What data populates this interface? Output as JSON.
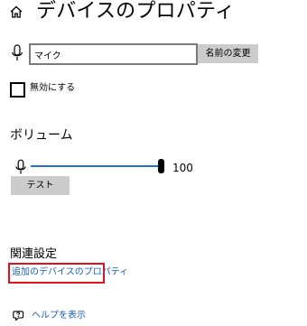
{
  "header": {
    "title": "デバイスのプロパティ",
    "home_icon": "home-icon"
  },
  "device_name": {
    "icon": "microphone-icon",
    "value": "マイク",
    "rename_label": "名前の変更"
  },
  "disable": {
    "label": "無効にする",
    "checked": false
  },
  "volume": {
    "heading": "ボリューム",
    "icon": "microphone-icon",
    "value": "100",
    "level_percent": 100,
    "test_label": "テスト"
  },
  "related": {
    "heading": "関連設定",
    "link_label": "追加のデバイスのプロパティ"
  },
  "help": {
    "icon": "help-chat-icon",
    "label": "ヘルプを表示"
  },
  "colors": {
    "accent": "#1f72c8",
    "link": "#1a5cb8",
    "button_bg": "#cccccc",
    "highlight_border": "#e0101d"
  }
}
